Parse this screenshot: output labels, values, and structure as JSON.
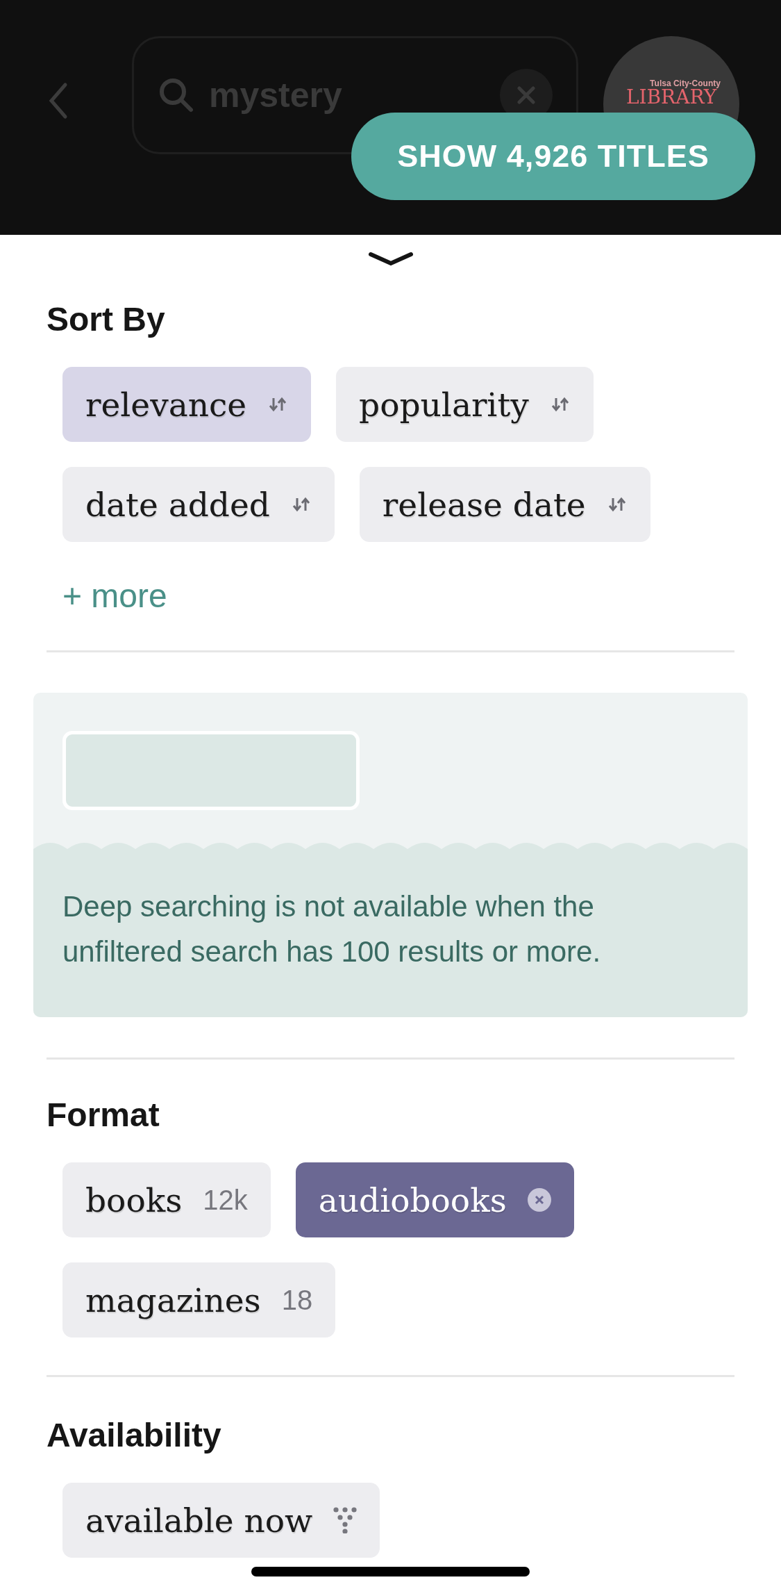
{
  "top_bar": {
    "search": {
      "value": "mystery"
    },
    "logo": {
      "line_1": "Tulsa City-County",
      "line_2": "LIBRARY"
    }
  },
  "show_button": {
    "label": "SHOW 4,926 TITLES"
  },
  "sort": {
    "title": "Sort By",
    "options": [
      {
        "label": "relevance",
        "selected": true
      },
      {
        "label": "popularity",
        "selected": false
      },
      {
        "label": "date added",
        "selected": false
      },
      {
        "label": "release date",
        "selected": false
      }
    ],
    "more_link": "+ more"
  },
  "deep_search": {
    "message": "Deep searching is not available when the unfiltered search has 100 results or more."
  },
  "format": {
    "title": "Format",
    "options": [
      {
        "label": "books",
        "count": "12k",
        "selected": false
      },
      {
        "label": "audiobooks",
        "selected": true
      },
      {
        "label": "magazines",
        "count": "18",
        "selected": false
      }
    ]
  },
  "availability": {
    "title": "Availability",
    "options": [
      {
        "label": "available now",
        "selected": false
      }
    ]
  }
}
